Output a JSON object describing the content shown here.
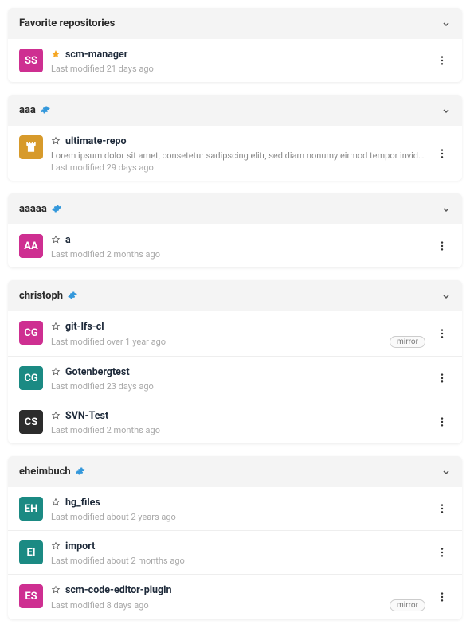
{
  "groups": [
    {
      "id": "favorites",
      "title": "Favorite repositories",
      "settings_icon": false,
      "repos": [
        {
          "avatar_text": "SS",
          "avatar_bg": "#ce2f91",
          "avatar_icon": null,
          "name": "scm-manager",
          "favorite": true,
          "description": null,
          "modified": "Last modified 21 days ago",
          "badge": null
        }
      ]
    },
    {
      "id": "aaa",
      "title": "aaa",
      "settings_icon": true,
      "repos": [
        {
          "avatar_text": null,
          "avatar_bg": "#d79a2b",
          "avatar_icon": "castle",
          "name": "ultimate-repo",
          "favorite": false,
          "description": "Lorem ipsum dolor sit amet, consetetur sadipscing elitr, sed diam nonumy eirmod tempor invidunt ut labore et dolore magna aliquyam e...",
          "modified": "Last modified 29 days ago",
          "badge": null
        }
      ]
    },
    {
      "id": "aaaaa",
      "title": "aaaaa",
      "settings_icon": true,
      "repos": [
        {
          "avatar_text": "AA",
          "avatar_bg": "#ce2f91",
          "avatar_icon": null,
          "name": "a",
          "favorite": false,
          "description": null,
          "modified": "Last modified 2 months ago",
          "badge": null
        }
      ]
    },
    {
      "id": "christoph",
      "title": "christoph",
      "settings_icon": true,
      "repos": [
        {
          "avatar_text": "CG",
          "avatar_bg": "#ce2f91",
          "avatar_icon": null,
          "name": "git-lfs-cl",
          "favorite": false,
          "description": null,
          "modified": "Last modified over 1 year ago",
          "badge": "mirror"
        },
        {
          "avatar_text": "CG",
          "avatar_bg": "#1b8a83",
          "avatar_icon": null,
          "name": "Gotenbergtest",
          "favorite": false,
          "description": null,
          "modified": "Last modified 23 days ago",
          "badge": null
        },
        {
          "avatar_text": "CS",
          "avatar_bg": "#2c2c2c",
          "avatar_icon": null,
          "name": "SVN-Test",
          "favorite": false,
          "description": null,
          "modified": "Last modified 2 months ago",
          "badge": null
        }
      ]
    },
    {
      "id": "eheimbuch",
      "title": "eheimbuch",
      "settings_icon": true,
      "repos": [
        {
          "avatar_text": "EH",
          "avatar_bg": "#1b8a83",
          "avatar_icon": null,
          "name": "hg_files",
          "favorite": false,
          "description": null,
          "modified": "Last modified about 2 years ago",
          "badge": null
        },
        {
          "avatar_text": "EI",
          "avatar_bg": "#1b8a83",
          "avatar_icon": null,
          "name": "import",
          "favorite": false,
          "description": null,
          "modified": "Last modified about 2 months ago",
          "badge": null
        },
        {
          "avatar_text": "ES",
          "avatar_bg": "#ce2f91",
          "avatar_icon": null,
          "name": "scm-code-editor-plugin",
          "favorite": false,
          "description": null,
          "modified": "Last modified 8 days ago",
          "badge": "mirror"
        }
      ]
    }
  ]
}
